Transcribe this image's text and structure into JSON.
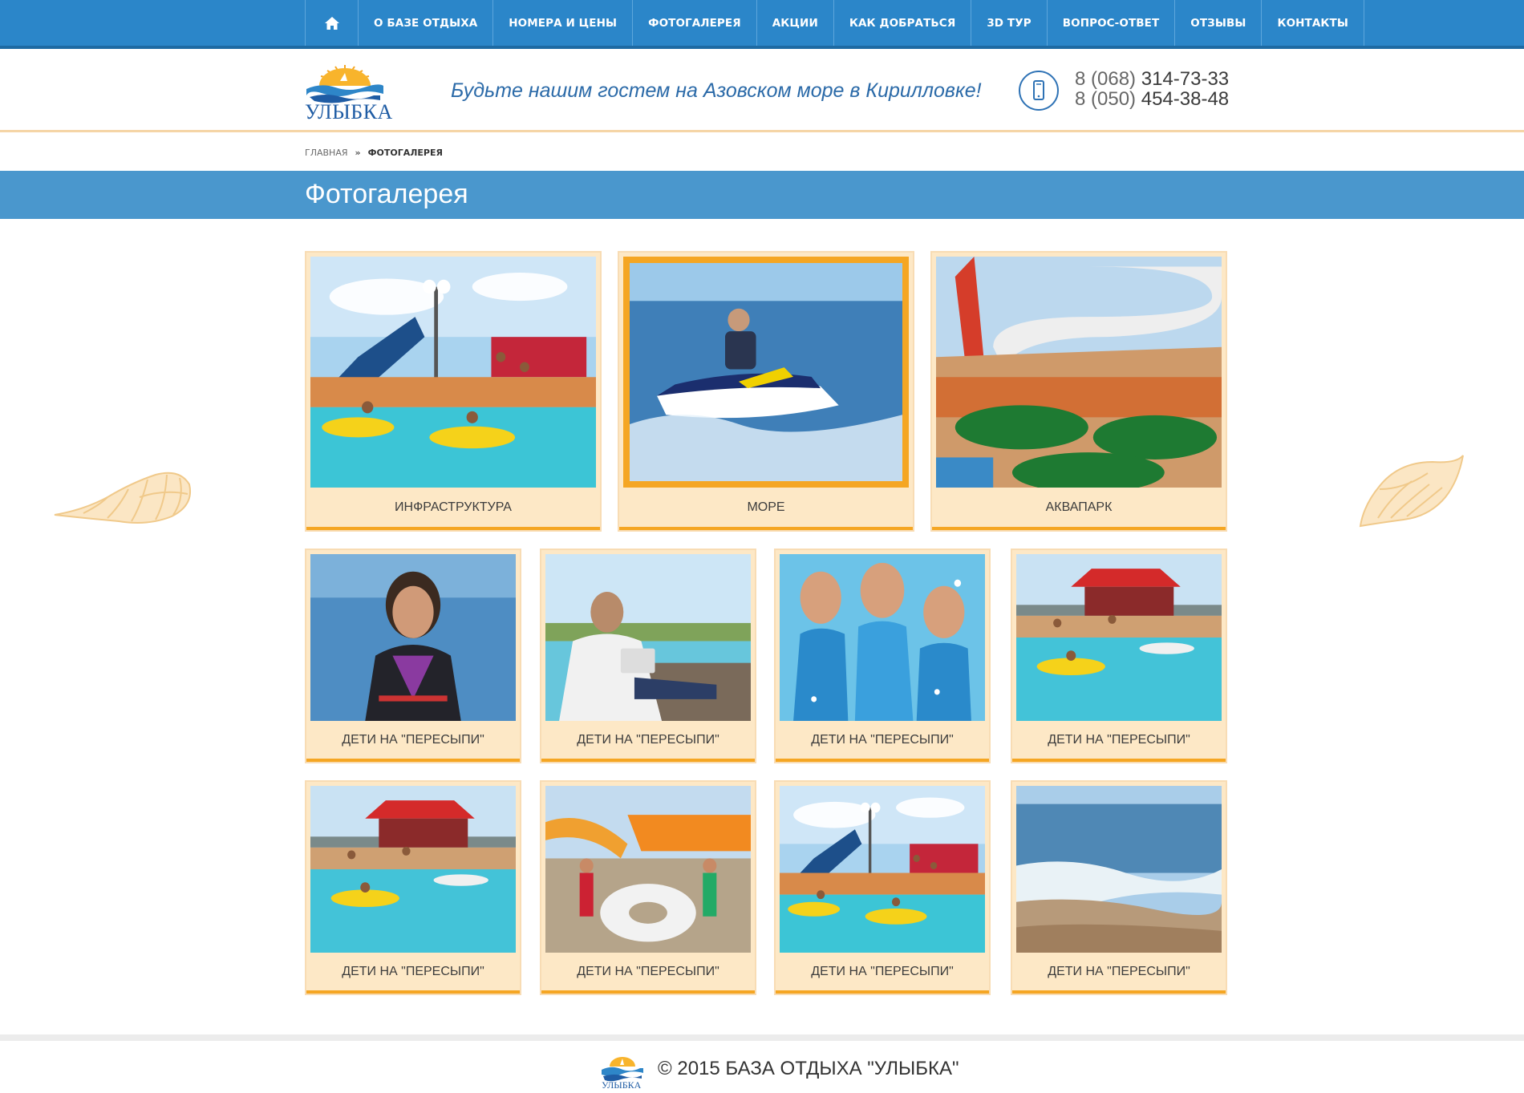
{
  "nav": {
    "items": [
      {
        "label": "О БАЗЕ ОТДЫХА"
      },
      {
        "label": "НОМЕРА И ЦЕНЫ"
      },
      {
        "label": "ФОТОГАЛЕРЕЯ"
      },
      {
        "label": "АКЦИИ"
      },
      {
        "label": "КАК ДОБРАТЬСЯ"
      },
      {
        "label": "3D ТУР"
      },
      {
        "label": "ВОПРОС-ОТВЕТ"
      },
      {
        "label": "ОТЗЫВЫ"
      },
      {
        "label": "КОНТАКТЫ"
      }
    ],
    "home_icon": "home-icon"
  },
  "header": {
    "logo_text": "УЛЫБКА",
    "slogan": "Будьте нашим гостем на Азовском море в Кирилловке!",
    "phone_icon": "mobile-phone-icon",
    "phones": [
      {
        "code": "8 (068)",
        "number": "314-73-33"
      },
      {
        "code": "8 (050)",
        "number": "454-38-48"
      }
    ]
  },
  "breadcrumb": {
    "home": "ГЛАВНАЯ",
    "separator": "»",
    "current": "ФОТОГАЛЕРЕЯ"
  },
  "page": {
    "title": "Фотогалерея"
  },
  "gallery": {
    "row1": [
      {
        "caption": "ИНФРАСТРУКТУРА",
        "scene": "pool"
      },
      {
        "caption": "МОРЕ",
        "scene": "jetski"
      },
      {
        "caption": "АКВАПАРК",
        "scene": "aquapark"
      }
    ],
    "row2": [
      {
        "caption": "ДЕТИ НА \"ПЕРЕСЫПИ\"",
        "scene": "woman-sea"
      },
      {
        "caption": "ДЕТИ НА \"ПЕРЕСЫПИ\"",
        "scene": "man-pool"
      },
      {
        "caption": "ДЕТИ НА \"ПЕРЕСЫПИ\"",
        "scene": "girls"
      },
      {
        "caption": "ДЕТИ НА \"ПЕРЕСЫПИ\"",
        "scene": "pool-cafe"
      }
    ],
    "row3": [
      {
        "caption": "ДЕТИ НА \"ПЕРЕСЫПИ\"",
        "scene": "pool-cafe"
      },
      {
        "caption": "ДЕТИ НА \"ПЕРЕСЫПИ\"",
        "scene": "slides"
      },
      {
        "caption": "ДЕТИ НА \"ПЕРЕСЫПИ\"",
        "scene": "pool"
      },
      {
        "caption": "ДЕТИ НА \"ПЕРЕСЫПИ\"",
        "scene": "beach"
      }
    ]
  },
  "footer": {
    "copyright": "© 2015 БАЗА ОТДЫХА \"УЛЫБКА\""
  },
  "colors": {
    "nav_bg": "#2b86c9",
    "title_band": "#4a97cd",
    "accent": "#f5a623",
    "card_bg": "#fde8c6",
    "brand_blue": "#1f5ca4"
  }
}
